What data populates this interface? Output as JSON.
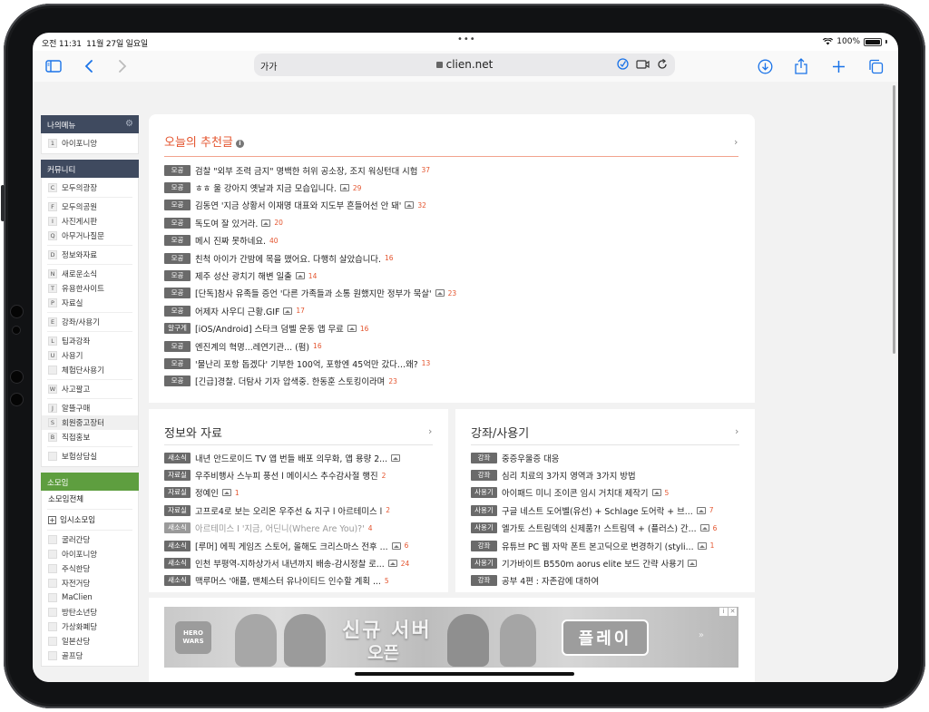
{
  "status_bar": {
    "time": "오전 11:31",
    "date": "11월 27일 일요일",
    "battery": "100%"
  },
  "browser": {
    "text_size_label": "가가",
    "url": "clien.net"
  },
  "sidebar": {
    "my_menu": {
      "title": "나의메뉴",
      "items": [
        {
          "key": "1",
          "label": "아이포니앙"
        }
      ]
    },
    "community": {
      "title": "커뮤니티",
      "groups": [
        [
          {
            "key": "C",
            "label": "모두의광장"
          }
        ],
        [
          {
            "key": "F",
            "label": "모두의공원"
          },
          {
            "key": "I",
            "label": "사진게시판"
          },
          {
            "key": "Q",
            "label": "아무거나질문"
          }
        ],
        [
          {
            "key": "D",
            "label": "정보와자료"
          }
        ],
        [
          {
            "key": "N",
            "label": "새로운소식"
          },
          {
            "key": "T",
            "label": "유용한사이트"
          },
          {
            "key": "P",
            "label": "자료실"
          }
        ],
        [
          {
            "key": "E",
            "label": "강좌/사용기"
          }
        ],
        [
          {
            "key": "L",
            "label": "팁과강좌"
          },
          {
            "key": "U",
            "label": "사용기"
          },
          {
            "key": "",
            "label": "체험단사용기"
          }
        ],
        [
          {
            "key": "W",
            "label": "사고팔고"
          }
        ],
        [
          {
            "key": "J",
            "label": "알뜰구매"
          },
          {
            "key": "S",
            "label": "회원중고장터"
          },
          {
            "key": "B",
            "label": "직접홍보"
          }
        ],
        [
          {
            "key": "",
            "label": "보험상담실"
          }
        ]
      ]
    },
    "somoim": {
      "title": "소모임",
      "all_label": "소모임전체",
      "temp_label": "임시소모임",
      "items": [
        "굴러간당",
        "아이포니앙",
        "주식한당",
        "자전거당",
        "MaClien",
        "방탄소년당",
        "가상화폐당",
        "일본산당",
        "골프당"
      ]
    }
  },
  "recommended": {
    "title": "오늘의 추천글",
    "posts": [
      {
        "tag": "모공",
        "title": "검찰 \"외부 조력 금지\" 명백한 허위 공소장, 조지 워싱턴대 시험",
        "image": false,
        "count": "37"
      },
      {
        "tag": "모공",
        "title": "ㅎㅎ 울 강아지 옛날과 지금 모습입니다.",
        "image": true,
        "count": "29"
      },
      {
        "tag": "모공",
        "title": "김동연 '지금 상황서 이재명 대표와 지도부 흔들어선 안 돼'",
        "image": true,
        "count": "32"
      },
      {
        "tag": "모공",
        "title": "독도여 잘 있거라.",
        "image": true,
        "count": "20"
      },
      {
        "tag": "모공",
        "title": "메시 진짜 못하네요.",
        "image": false,
        "count": "40"
      },
      {
        "tag": "모공",
        "title": "친척 아이가 간밤에 목을 맸어요. 다행히 살았습니다.",
        "image": false,
        "count": "16"
      },
      {
        "tag": "모공",
        "title": "제주 성산 광치기 해변 일출",
        "image": true,
        "count": "14"
      },
      {
        "tag": "모공",
        "title": "[단독]참사 유족들 증언 '다른 가족들과 소통 원했지만 정부가 묵살'",
        "image": true,
        "count": "23"
      },
      {
        "tag": "모공",
        "title": "어제자 사우디 근황.GIF",
        "image": true,
        "count": "17"
      },
      {
        "tag": "알구게",
        "title": "[iOS/Android] 스타크 덤벨 운동 앱 무료",
        "image": true,
        "count": "16"
      },
      {
        "tag": "모공",
        "title": "엔진계의 혁명...레연기관... (펌)",
        "image": false,
        "count": "16"
      },
      {
        "tag": "모공",
        "title": "'물난리 포항 돕겠다' 기부한 100억, 포항엔 45억만 갔다…왜?",
        "image": false,
        "count": "13"
      },
      {
        "tag": "모공",
        "title": "[긴급]경찰. 더탐사 기자 압색중. 한동훈 스토킹이라며",
        "image": false,
        "count": "23"
      }
    ]
  },
  "info_board": {
    "title": "정보와 자료",
    "posts": [
      {
        "tag": "새소식",
        "title": "내년 안드로이드 TV 앱 번들 배포 의무화, 앱 용량 2...",
        "image": true,
        "count": "",
        "faded": false
      },
      {
        "tag": "자료실",
        "title": "우주비행사 스누피 풍선 l 메이시스 추수감사절 행진",
        "image": false,
        "count": "2",
        "faded": false
      },
      {
        "tag": "자료실",
        "title": "정예인",
        "image": true,
        "count": "1",
        "faded": false
      },
      {
        "tag": "자료실",
        "title": "고프로4로 보는 오리온 우주선 & 지구 l 아르테미스 l",
        "image": false,
        "count": "2",
        "faded": false
      },
      {
        "tag": "새소식",
        "title": "아르테미스 I '지금, 어딘니(Where Are You)?'",
        "image": false,
        "count": "4",
        "faded": true
      },
      {
        "tag": "새소식",
        "title": "[루머] 에픽 게임즈 스토어, 올해도 크리스마스 전후 ...",
        "image": true,
        "count": "6",
        "faded": false
      },
      {
        "tag": "새소식",
        "title": "인천 부평역-지하상가서 내년까지 배송-감시정찰 로...",
        "image": true,
        "count": "24",
        "faded": false
      },
      {
        "tag": "새소식",
        "title": "맥루머스 '애플, 맨체스터 유나이티드 인수할 계획 ...",
        "image": false,
        "count": "5",
        "faded": false
      }
    ]
  },
  "lecture_board": {
    "title": "강좌/사용기",
    "posts": [
      {
        "tag": "강좌",
        "title": "중증우울증 대응",
        "image": false,
        "count": ""
      },
      {
        "tag": "강좌",
        "title": "심리 치료의 3가지 영역과 3가지 방법",
        "image": false,
        "count": ""
      },
      {
        "tag": "사용기",
        "title": "아이패드 미니 조이콘 임시 거치대 제작기",
        "image": true,
        "count": "5"
      },
      {
        "tag": "사용기",
        "title": "구글 네스트 도어벨(유선) + Schlage 도어락 + 브...",
        "image": true,
        "count": "7"
      },
      {
        "tag": "사용기",
        "title": "엘가토 스트림덱의 신제품?! 스트림덱 + (플러스) 간...",
        "image": true,
        "count": "6"
      },
      {
        "tag": "강좌",
        "title": "유튜브 PC 웹 자막 폰트 본고딕으로 변경하기 (styli...",
        "image": true,
        "count": "1"
      },
      {
        "tag": "사용기",
        "title": "기가바이트 B550m aorus elite 보드 간략 사용기",
        "image": true,
        "count": ""
      },
      {
        "tag": "강좌",
        "title": "공부 4편 : 자존감에 대하여",
        "image": false,
        "count": ""
      }
    ]
  },
  "ad": {
    "logo": "HERO WARS",
    "headline": "신규 서버",
    "subline": "오픈",
    "cta": "플레이"
  }
}
